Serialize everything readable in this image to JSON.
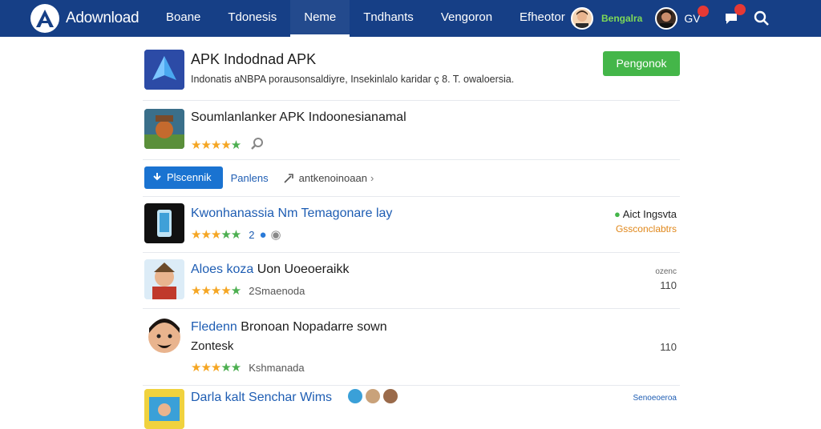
{
  "header": {
    "brand": "Adownload",
    "nav": [
      "Boane",
      "Tdonesis",
      "Neme",
      "Tndhants",
      "Vengoron",
      "Efheotor"
    ],
    "active_nav": 2,
    "user_name": "Bengalra",
    "badge_label": "GV",
    "colors": {
      "bar": "#163f86",
      "accent_green": "#44b649",
      "accent_blue": "#1a73d1"
    }
  },
  "featured": {
    "title": "APK Indodnad APK",
    "description": "Indonatis aNBPA porausonsaldiyre, Insekinlalo karidar ç 8. T. owaloersia.",
    "button": "Pengonok"
  },
  "item1": {
    "title": "Soumlanlanker APK Indoonesianamal"
  },
  "actions": {
    "download": "Plscennik",
    "secondary": "Panlens",
    "share": "antkenoinoaan"
  },
  "list": [
    {
      "title": "Kwonhanassia Nm Temagonare lay",
      "meta": "2",
      "right_top": "Aict Ingsvta",
      "right_bottom": "Gssconclabtrs"
    },
    {
      "title": "Aloes koza",
      "title_b": "Uon Uoeoeraikk",
      "meta": "2Smaenoda",
      "right_top": "ozenc",
      "right_bottom": "110"
    },
    {
      "title": "Fledenn",
      "title_b": "Bronoan Nopadarre sown",
      "subtitle": "Zontesk",
      "meta": "Kshmanada",
      "right_bottom": "110"
    },
    {
      "title": "Darla kalt",
      "title_b": "Senchar Wims",
      "right_top": "Senoeoeroa"
    }
  ]
}
